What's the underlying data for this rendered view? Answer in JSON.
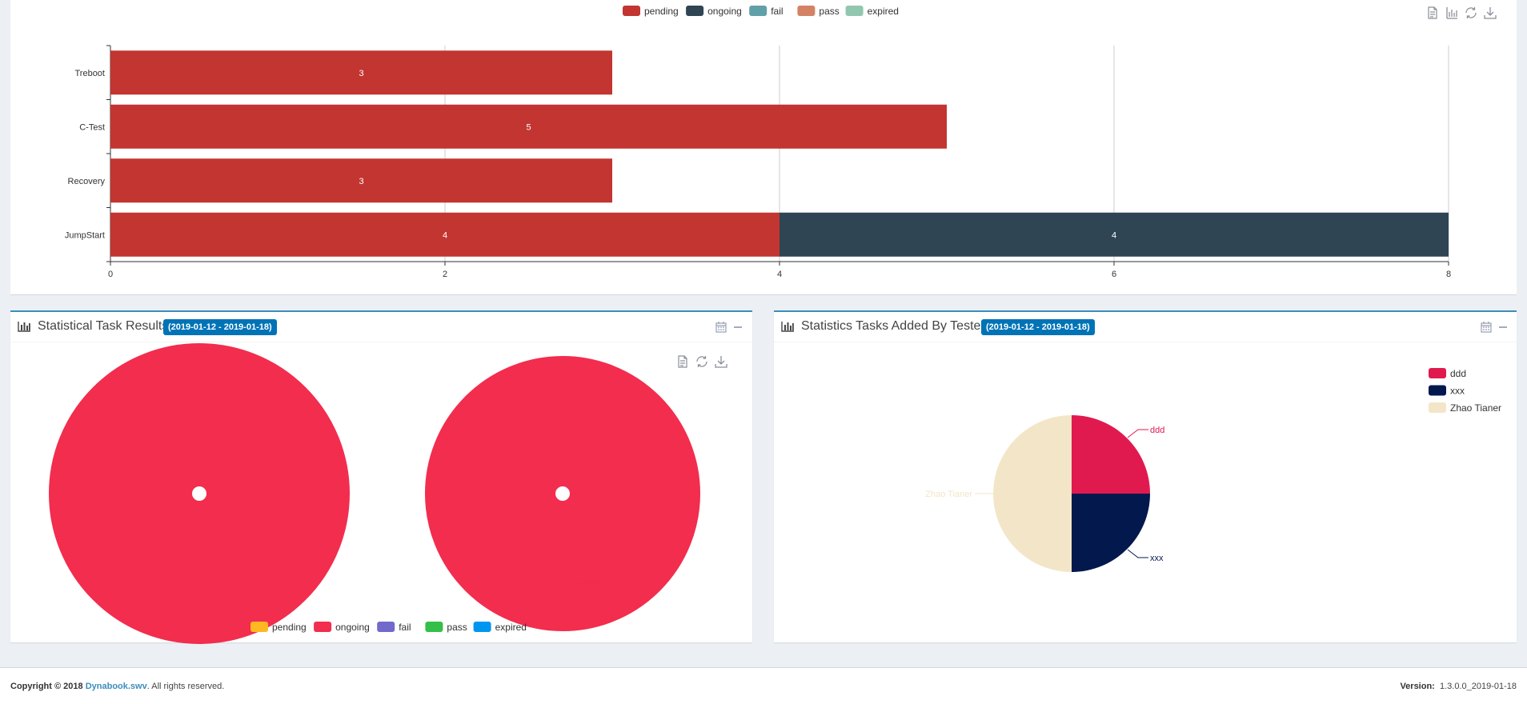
{
  "bar_chart": {
    "legend": [
      {
        "label": "pending",
        "color": "#c23531"
      },
      {
        "label": "ongoing",
        "color": "#2f4554"
      },
      {
        "label": "fail",
        "color": "#61a0a8"
      },
      {
        "label": "pass",
        "color": "#d48265"
      },
      {
        "label": "expired",
        "color": "#91c7ae"
      }
    ]
  },
  "left_box": {
    "title": "Statistical Task Results",
    "date_range": "(2019-01-12 - 2019-01-18)",
    "legend": [
      {
        "label": "pending",
        "color": "#ffb822"
      },
      {
        "label": "ongoing",
        "color": "#f22d4e"
      },
      {
        "label": "fail",
        "color": "#716aca"
      },
      {
        "label": "pass",
        "color": "#34bf49"
      },
      {
        "label": "expired",
        "color": "#0096f0"
      }
    ],
    "label_ongoing": "ongoing"
  },
  "right_box": {
    "title": "Statistics Tasks Added By Testers",
    "date_range": "(2019-01-12 - 2019-01-18)",
    "legend": [
      {
        "label": "ddd",
        "color": "#e01a4f"
      },
      {
        "label": "xxx",
        "color": "#03184d"
      },
      {
        "label": "Zhao Tianer",
        "color": "#f3e6c8"
      }
    ],
    "label_ddd": "ddd",
    "label_xxx": "xxx",
    "label_zhao": "Zhao Tianer"
  },
  "footer": {
    "copyright_prefix": "Copyright © 2018",
    "brand": "Dynabook.swv",
    "rights": ". All rights reserved.",
    "version_label": "Version:",
    "version_value": "1.3.0.0_2019-01-18"
  },
  "chart_data": [
    {
      "type": "bar",
      "orientation": "horizontal",
      "stacked": true,
      "categories": [
        "Treboot",
        "C-Test",
        "Recovery",
        "JumpStart"
      ],
      "series": [
        {
          "name": "pending",
          "values": [
            3,
            5,
            3,
            4
          ],
          "color": "#c23531"
        },
        {
          "name": "ongoing",
          "values": [
            0,
            0,
            0,
            4
          ],
          "color": "#2f4554"
        },
        {
          "name": "fail",
          "values": [
            0,
            0,
            0,
            0
          ],
          "color": "#61a0a8"
        },
        {
          "name": "pass",
          "values": [
            0,
            0,
            0,
            0
          ],
          "color": "#d48265"
        },
        {
          "name": "expired",
          "values": [
            0,
            0,
            0,
            0
          ],
          "color": "#91c7ae"
        }
      ],
      "xlim": [
        0,
        8
      ],
      "xticks": [
        0,
        2,
        4,
        6,
        8
      ],
      "grid": true,
      "legend_position": "top-center"
    },
    {
      "type": "pie",
      "variant": "donut",
      "slices": [
        {
          "label": "ongoing",
          "value": 1,
          "color": "#f22d4e"
        }
      ],
      "legend_position": "bottom-center"
    },
    {
      "type": "pie",
      "variant": "donut",
      "slices": [
        {
          "label": "ongoing",
          "value": 1,
          "color": "#f22d4e"
        }
      ],
      "legend_position": "bottom-center"
    },
    {
      "type": "pie",
      "slices": [
        {
          "label": "ddd",
          "value": 1,
          "color": "#e01a4f"
        },
        {
          "label": "xxx",
          "value": 1,
          "color": "#03184d"
        },
        {
          "label": "Zhao Tianer",
          "value": 2,
          "color": "#f3e6c8"
        }
      ],
      "legend_position": "right"
    }
  ]
}
